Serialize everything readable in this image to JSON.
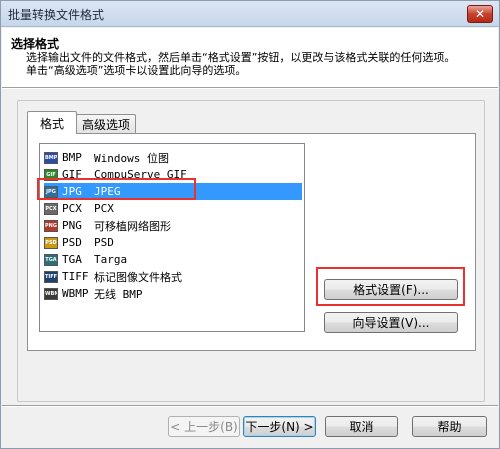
{
  "window": {
    "title": "批量转换文件格式",
    "close_label": "✕"
  },
  "header": {
    "title": "选择格式",
    "description": "选择输出文件的文件格式，然后单击“格式设置”按钮，以更改与该格式关联的任何选项。单击“高级选项”选项卡以设置此向导的选项。"
  },
  "tabs": [
    {
      "label": "格式",
      "active": true
    },
    {
      "label": "高级选项",
      "active": false
    }
  ],
  "formats": [
    {
      "code": "BMP",
      "name": "Windows 位图",
      "icon": "bmp-icon",
      "icon_color": "#2b4da8",
      "selected": false
    },
    {
      "code": "GIF",
      "name": "CompuServe GIF",
      "icon": "gif-icon",
      "icon_color": "#2a8a2a",
      "selected": false
    },
    {
      "code": "JPG",
      "name": "JPEG",
      "icon": "jpg-icon",
      "icon_color": "#2f6fa0",
      "selected": true
    },
    {
      "code": "PCX",
      "name": "PCX",
      "icon": "pcx-icon",
      "icon_color": "#6a6a6a",
      "selected": false
    },
    {
      "code": "PNG",
      "name": "可移植网络图形",
      "icon": "png-icon",
      "icon_color": "#b33a2a",
      "selected": false
    },
    {
      "code": "PSD",
      "name": "PSD",
      "icon": "psd-icon",
      "icon_color": "#c99a12",
      "selected": false
    },
    {
      "code": "TGA",
      "name": "Targa",
      "icon": "tga-icon",
      "icon_color": "#2a6f7a",
      "selected": false
    },
    {
      "code": "TIFF",
      "name": "标记图像文件格式",
      "icon": "tiff-icon",
      "icon_color": "#1e4070",
      "selected": false
    },
    {
      "code": "WBMP",
      "name": "无线 BMP",
      "icon": "wbmp-icon",
      "icon_color": "#3a3a3a",
      "selected": false
    }
  ],
  "buttons": {
    "format_settings": "格式设置(F)...",
    "wizard_settings": "向导设置(V)...",
    "back": "< 上一步(B)",
    "next": "下一步(N) >",
    "cancel": "取消",
    "help": "帮助"
  },
  "colors": {
    "selection": "#3399ff",
    "annotation": "#e8322d"
  }
}
